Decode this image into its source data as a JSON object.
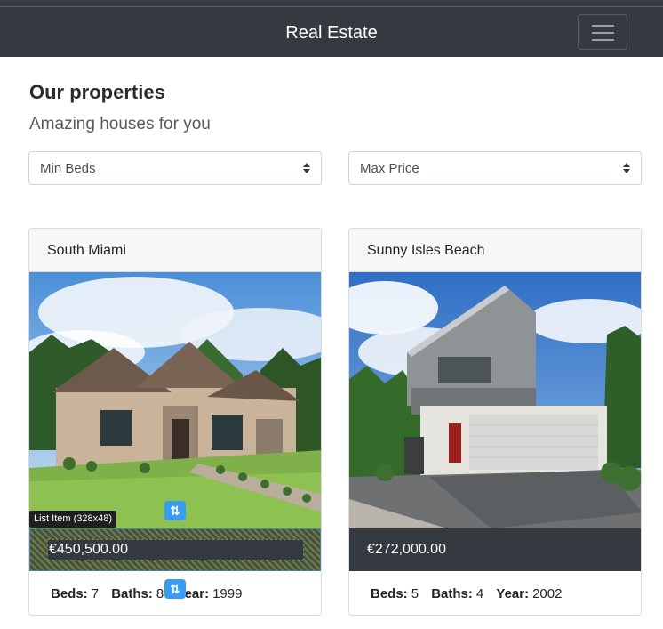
{
  "navbar": {
    "brand": "Real Estate",
    "menu_icon": "hamburger-icon"
  },
  "header": {
    "title": "Our properties",
    "subtitle": "Amazing houses for you"
  },
  "filters": {
    "min_beds": {
      "selected": "Min Beds"
    },
    "max_price": {
      "selected": "Max Price"
    }
  },
  "listings": [
    {
      "name": "South Miami",
      "price": "€450,500.00",
      "beds_label": "Beds:",
      "beds": "7",
      "baths_label": "Baths:",
      "baths": "8",
      "year_label": "Year:",
      "year": "1999"
    },
    {
      "name": "Sunny Isles Beach",
      "price": "€272,000.00",
      "beds_label": "Beds:",
      "beds": "5",
      "baths_label": "Baths:",
      "baths": "4",
      "year_label": "Year:",
      "year": "2002"
    }
  ],
  "devtools": {
    "tooltip": "List Item (328x48)"
  },
  "colors": {
    "navbar": "#343a40",
    "price_bar": "#343a40",
    "handle": "#3a9bf4"
  }
}
